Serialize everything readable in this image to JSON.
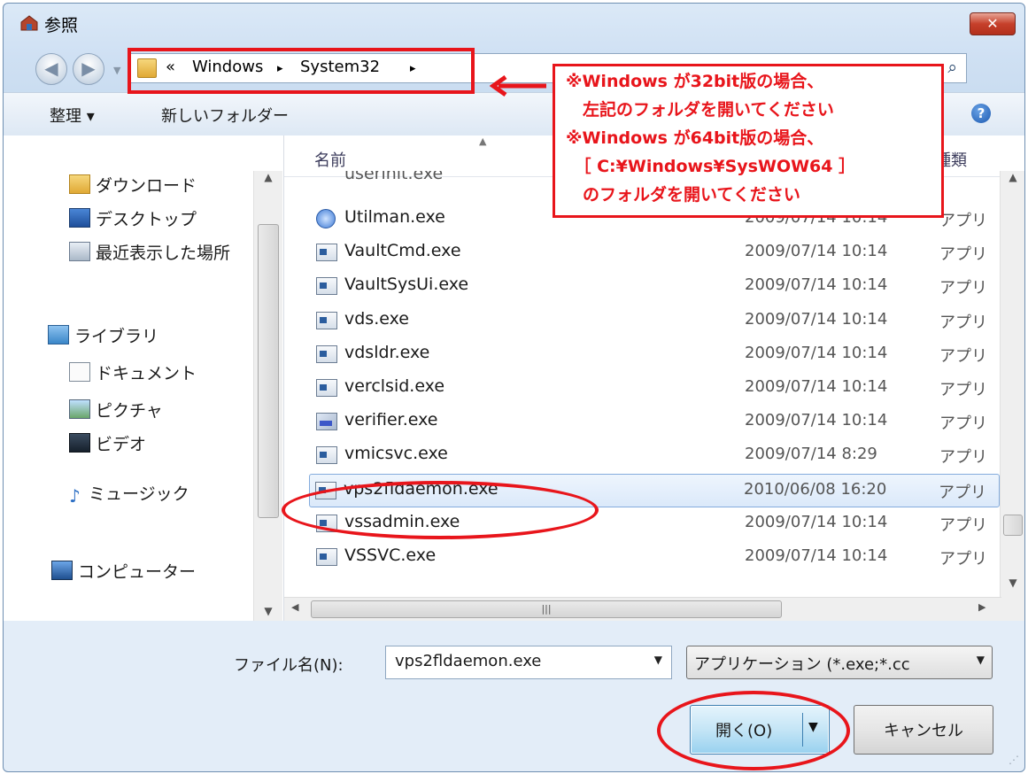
{
  "window": {
    "title": "参照",
    "close_label": "✕"
  },
  "address": {
    "overflow": "«",
    "segments": [
      "Windows",
      "System32"
    ],
    "separator": "▸"
  },
  "toolbar": {
    "organize": "整理 ▾",
    "new_folder": "新しいフォルダー"
  },
  "nav": {
    "items": [
      {
        "label": "ダウンロード",
        "icon": "download-folder-icon"
      },
      {
        "label": "デスクトップ",
        "icon": "desktop-icon"
      },
      {
        "label": "最近表示した場所",
        "icon": "recent-places-icon"
      },
      {
        "label": "ライブラリ",
        "icon": "library-icon"
      },
      {
        "label": "ドキュメント",
        "icon": "documents-icon"
      },
      {
        "label": "ピクチャ",
        "icon": "pictures-icon"
      },
      {
        "label": "ビデオ",
        "icon": "videos-icon"
      },
      {
        "label": "ミュージック",
        "icon": "music-icon"
      },
      {
        "label": "コンピューター",
        "icon": "computer-icon"
      }
    ]
  },
  "files": {
    "columns": {
      "name": "名前",
      "type": "種類"
    },
    "partial_row": "userinit.exe",
    "rows": [
      {
        "name": "Utilman.exe",
        "date": "2009/07/14 10:14",
        "type": "アプリ",
        "icon": "utilman-icon"
      },
      {
        "name": "VaultCmd.exe",
        "date": "2009/07/14 10:14",
        "type": "アプリ",
        "icon": "exe-icon"
      },
      {
        "name": "VaultSysUi.exe",
        "date": "2009/07/14 10:14",
        "type": "アプリ",
        "icon": "exe-icon"
      },
      {
        "name": "vds.exe",
        "date": "2009/07/14 10:14",
        "type": "アプリ",
        "icon": "exe-icon"
      },
      {
        "name": "vdsldr.exe",
        "date": "2009/07/14 10:14",
        "type": "アプリ",
        "icon": "exe-icon"
      },
      {
        "name": "verclsid.exe",
        "date": "2009/07/14 10:14",
        "type": "アプリ",
        "icon": "exe-icon"
      },
      {
        "name": "verifier.exe",
        "date": "2009/07/14 10:14",
        "type": "アプリ",
        "icon": "verifier-icon"
      },
      {
        "name": "vmicsvc.exe",
        "date": "2009/07/14 8:29",
        "type": "アプリ",
        "icon": "exe-icon"
      },
      {
        "name": "vps2fldaemon.exe",
        "date": "2010/06/08 16:20",
        "type": "アプリ",
        "icon": "exe-icon",
        "selected": true
      },
      {
        "name": "vssadmin.exe",
        "date": "2009/07/14 10:14",
        "type": "アプリ",
        "icon": "exe-icon"
      },
      {
        "name": "VSSVC.exe",
        "date": "2009/07/14 10:14",
        "type": "アプリ",
        "icon": "exe-icon"
      }
    ]
  },
  "bottom": {
    "filename_label": "ファイル名(N):",
    "filename_value": "vps2fldaemon.exe",
    "filetype_value": "アプリケーション (*.exe;*.cc",
    "open_label": "開く(O)",
    "cancel_label": "キャンセル"
  },
  "annotation": {
    "lines": [
      "※Windows が32bit版の場合、",
      "　左記のフォルダを開いてください",
      "※Windows が64bit版の場合、",
      "　［ C:¥Windows¥SysWOW64 ］",
      "　のフォルダを開いてください"
    ],
    "color": "#e8151b"
  }
}
